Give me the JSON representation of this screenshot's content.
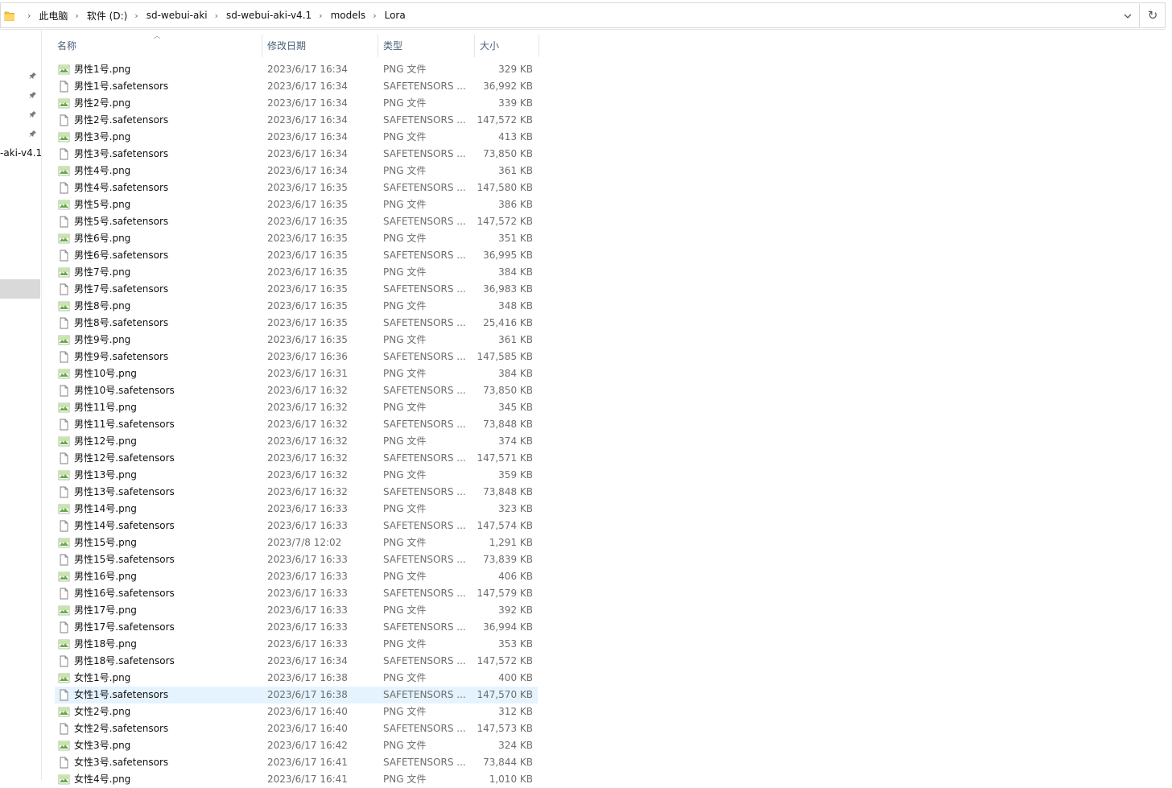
{
  "breadcrumb": [
    "此电脑",
    "软件 (D:)",
    "sd-webui-aki",
    "sd-webui-aki-v4.1",
    "models",
    "Lora"
  ],
  "nav": {
    "partial_label": "-aki-v4.1"
  },
  "columns": {
    "name": "名称",
    "date": "修改日期",
    "type": "类型",
    "size": "大小"
  },
  "files": [
    {
      "name": "男性1号.png",
      "date": "2023/6/17 16:34",
      "type": "PNG 文件",
      "size": "329 KB",
      "kind": "png"
    },
    {
      "name": "男性1号.safetensors",
      "date": "2023/6/17 16:34",
      "type": "SAFETENSORS ...",
      "size": "36,992 KB",
      "kind": "file"
    },
    {
      "name": "男性2号.png",
      "date": "2023/6/17 16:34",
      "type": "PNG 文件",
      "size": "339 KB",
      "kind": "png"
    },
    {
      "name": "男性2号.safetensors",
      "date": "2023/6/17 16:34",
      "type": "SAFETENSORS ...",
      "size": "147,572 KB",
      "kind": "file"
    },
    {
      "name": "男性3号.png",
      "date": "2023/6/17 16:34",
      "type": "PNG 文件",
      "size": "413 KB",
      "kind": "png"
    },
    {
      "name": "男性3号.safetensors",
      "date": "2023/6/17 16:34",
      "type": "SAFETENSORS ...",
      "size": "73,850 KB",
      "kind": "file"
    },
    {
      "name": "男性4号.png",
      "date": "2023/6/17 16:34",
      "type": "PNG 文件",
      "size": "361 KB",
      "kind": "png"
    },
    {
      "name": "男性4号.safetensors",
      "date": "2023/6/17 16:35",
      "type": "SAFETENSORS ...",
      "size": "147,580 KB",
      "kind": "file"
    },
    {
      "name": "男性5号.png",
      "date": "2023/6/17 16:35",
      "type": "PNG 文件",
      "size": "386 KB",
      "kind": "png"
    },
    {
      "name": "男性5号.safetensors",
      "date": "2023/6/17 16:35",
      "type": "SAFETENSORS ...",
      "size": "147,572 KB",
      "kind": "file"
    },
    {
      "name": "男性6号.png",
      "date": "2023/6/17 16:35",
      "type": "PNG 文件",
      "size": "351 KB",
      "kind": "png"
    },
    {
      "name": "男性6号.safetensors",
      "date": "2023/6/17 16:35",
      "type": "SAFETENSORS ...",
      "size": "36,995 KB",
      "kind": "file"
    },
    {
      "name": "男性7号.png",
      "date": "2023/6/17 16:35",
      "type": "PNG 文件",
      "size": "384 KB",
      "kind": "png"
    },
    {
      "name": "男性7号.safetensors",
      "date": "2023/6/17 16:35",
      "type": "SAFETENSORS ...",
      "size": "36,983 KB",
      "kind": "file"
    },
    {
      "name": "男性8号.png",
      "date": "2023/6/17 16:35",
      "type": "PNG 文件",
      "size": "348 KB",
      "kind": "png"
    },
    {
      "name": "男性8号.safetensors",
      "date": "2023/6/17 16:35",
      "type": "SAFETENSORS ...",
      "size": "25,416 KB",
      "kind": "file"
    },
    {
      "name": "男性9号.png",
      "date": "2023/6/17 16:35",
      "type": "PNG 文件",
      "size": "361 KB",
      "kind": "png"
    },
    {
      "name": "男性9号.safetensors",
      "date": "2023/6/17 16:36",
      "type": "SAFETENSORS ...",
      "size": "147,585 KB",
      "kind": "file"
    },
    {
      "name": "男性10号.png",
      "date": "2023/6/17 16:31",
      "type": "PNG 文件",
      "size": "384 KB",
      "kind": "png"
    },
    {
      "name": "男性10号.safetensors",
      "date": "2023/6/17 16:32",
      "type": "SAFETENSORS ...",
      "size": "73,850 KB",
      "kind": "file"
    },
    {
      "name": "男性11号.png",
      "date": "2023/6/17 16:32",
      "type": "PNG 文件",
      "size": "345 KB",
      "kind": "png"
    },
    {
      "name": "男性11号.safetensors",
      "date": "2023/6/17 16:32",
      "type": "SAFETENSORS ...",
      "size": "73,848 KB",
      "kind": "file"
    },
    {
      "name": "男性12号.png",
      "date": "2023/6/17 16:32",
      "type": "PNG 文件",
      "size": "374 KB",
      "kind": "png"
    },
    {
      "name": "男性12号.safetensors",
      "date": "2023/6/17 16:32",
      "type": "SAFETENSORS ...",
      "size": "147,571 KB",
      "kind": "file"
    },
    {
      "name": "男性13号.png",
      "date": "2023/6/17 16:32",
      "type": "PNG 文件",
      "size": "359 KB",
      "kind": "png"
    },
    {
      "name": "男性13号.safetensors",
      "date": "2023/6/17 16:32",
      "type": "SAFETENSORS ...",
      "size": "73,848 KB",
      "kind": "file"
    },
    {
      "name": "男性14号.png",
      "date": "2023/6/17 16:33",
      "type": "PNG 文件",
      "size": "323 KB",
      "kind": "png"
    },
    {
      "name": "男性14号.safetensors",
      "date": "2023/6/17 16:33",
      "type": "SAFETENSORS ...",
      "size": "147,574 KB",
      "kind": "file"
    },
    {
      "name": "男性15号.png",
      "date": "2023/7/8 12:02",
      "type": "PNG 文件",
      "size": "1,291 KB",
      "kind": "png"
    },
    {
      "name": "男性15号.safetensors",
      "date": "2023/6/17 16:33",
      "type": "SAFETENSORS ...",
      "size": "73,839 KB",
      "kind": "file"
    },
    {
      "name": "男性16号.png",
      "date": "2023/6/17 16:33",
      "type": "PNG 文件",
      "size": "406 KB",
      "kind": "png"
    },
    {
      "name": "男性16号.safetensors",
      "date": "2023/6/17 16:33",
      "type": "SAFETENSORS ...",
      "size": "147,579 KB",
      "kind": "file"
    },
    {
      "name": "男性17号.png",
      "date": "2023/6/17 16:33",
      "type": "PNG 文件",
      "size": "392 KB",
      "kind": "png"
    },
    {
      "name": "男性17号.safetensors",
      "date": "2023/6/17 16:33",
      "type": "SAFETENSORS ...",
      "size": "36,994 KB",
      "kind": "file"
    },
    {
      "name": "男性18号.png",
      "date": "2023/6/17 16:33",
      "type": "PNG 文件",
      "size": "353 KB",
      "kind": "png"
    },
    {
      "name": "男性18号.safetensors",
      "date": "2023/6/17 16:34",
      "type": "SAFETENSORS ...",
      "size": "147,572 KB",
      "kind": "file"
    },
    {
      "name": "女性1号.png",
      "date": "2023/6/17 16:38",
      "type": "PNG 文件",
      "size": "400 KB",
      "kind": "png"
    },
    {
      "name": "女性1号.safetensors",
      "date": "2023/6/17 16:38",
      "type": "SAFETENSORS ...",
      "size": "147,570 KB",
      "kind": "file",
      "selected": true
    },
    {
      "name": "女性2号.png",
      "date": "2023/6/17 16:40",
      "type": "PNG 文件",
      "size": "312 KB",
      "kind": "png"
    },
    {
      "name": "女性2号.safetensors",
      "date": "2023/6/17 16:40",
      "type": "SAFETENSORS ...",
      "size": "147,573 KB",
      "kind": "file"
    },
    {
      "name": "女性3号.png",
      "date": "2023/6/17 16:42",
      "type": "PNG 文件",
      "size": "324 KB",
      "kind": "png"
    },
    {
      "name": "女性3号.safetensors",
      "date": "2023/6/17 16:41",
      "type": "SAFETENSORS ...",
      "size": "73,844 KB",
      "kind": "file"
    },
    {
      "name": "女性4号.png",
      "date": "2023/6/17 16:41",
      "type": "PNG 文件",
      "size": "1,010 KB",
      "kind": "png"
    }
  ],
  "colors": {
    "selected_row": "#e5f3ff",
    "header_text": "#4c607a",
    "secondary_text": "#6d6d6d",
    "png_icon": "#6aa84f",
    "folder": "#f4c542"
  }
}
